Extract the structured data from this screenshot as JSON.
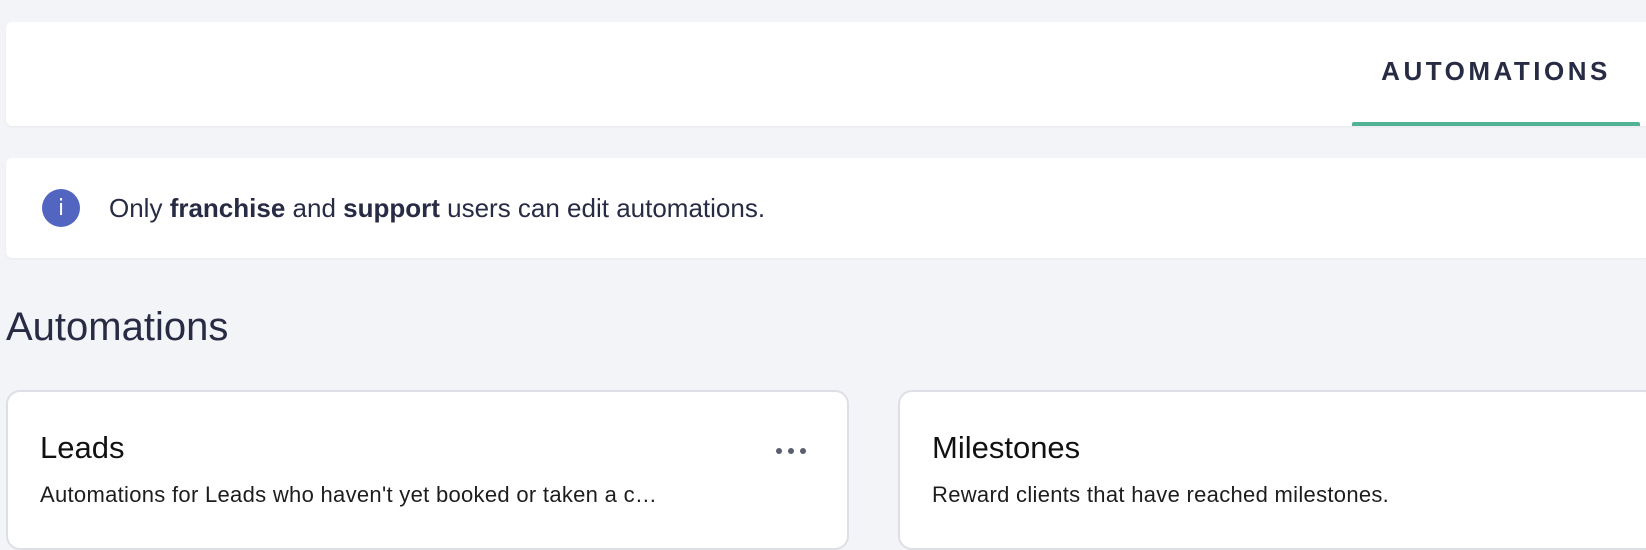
{
  "tabs": [
    {
      "label": "AUTOMATIONS",
      "active": true
    }
  ],
  "notice": {
    "icon": "info-icon",
    "icon_glyph": "i",
    "parts": {
      "p1": "Only ",
      "b1": "franchise",
      "p2": " and ",
      "b2": "support",
      "p3": " users can edit automations."
    }
  },
  "section": {
    "title": "Automations"
  },
  "cards": [
    {
      "title": "Leads",
      "description": "Automations for Leads who haven't yet booked or taken a c…",
      "menu_icon": "more-horizontal-icon"
    },
    {
      "title": "Milestones",
      "description": "Reward clients that have reached milestones."
    }
  ],
  "colors": {
    "background": "#f3f4f8",
    "accent": "#52b295",
    "info": "#5266c1",
    "text": "#272b44"
  }
}
